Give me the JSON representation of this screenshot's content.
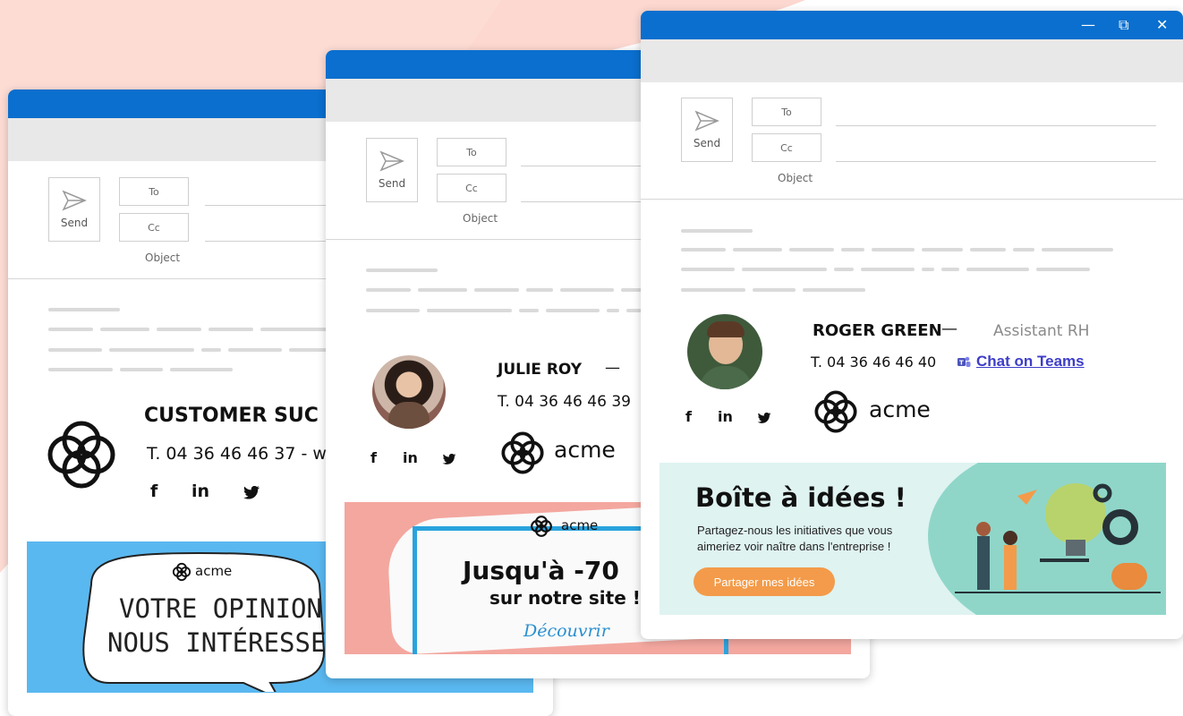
{
  "colors": {
    "accent": "#0a6fce",
    "toolbar": "#e8e8e8",
    "banner_blue": "#5ab8f0",
    "banner_pink": "#f3a79f",
    "banner_mint": "#d7f0ee",
    "button_orange": "#f39b4a",
    "teams_link": "#3d3dc8"
  },
  "compose": {
    "send_label": "Send",
    "to_label": "To",
    "cc_label": "Cc",
    "object_label": "Object"
  },
  "window_controls": {
    "minimize": "—",
    "restore": "⧉",
    "close": "✕"
  },
  "signature1": {
    "name": "CUSTOMER SUC",
    "phone": "T. 04 36 46 46 37 - w",
    "social": [
      "f",
      "in",
      "twitter-icon"
    ],
    "banner": {
      "brand": "acme",
      "line1": "VOTRE OPINION",
      "line2": "NOUS INTÉRESSE"
    }
  },
  "signature2": {
    "name": "JULIE ROY",
    "name_dash": "—",
    "phone": "T. 04 36 46 46 39",
    "brand": "acme",
    "social": [
      "f",
      "in",
      "twitter-icon"
    ],
    "banner": {
      "brand": "acme",
      "headline": "Jusqu'à -70",
      "subline": "sur notre site !",
      "cta": "Découvrir"
    }
  },
  "signature3": {
    "name": "ROGER GREEN",
    "name_dash": "—",
    "role": "Assistant RH",
    "phone": "T. 04 36 46 46 40",
    "teams_link": "Chat on Teams",
    "brand": "acme",
    "social": [
      "f",
      "in",
      "twitter-icon"
    ],
    "banner": {
      "title": "Boîte à idées !",
      "text_line1": "Partagez-nous les initiatives que vous",
      "text_line2": "aimeriez voir naître dans l'entreprise !",
      "button": "Partager mes idées"
    }
  }
}
